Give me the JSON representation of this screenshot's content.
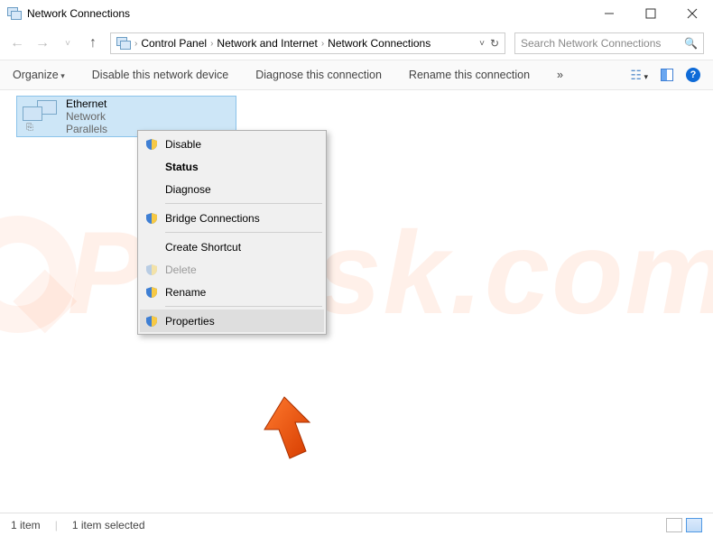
{
  "window": {
    "title": "Network Connections"
  },
  "breadcrumbs": {
    "root": "Control Panel",
    "mid": "Network and Internet",
    "leaf": "Network Connections"
  },
  "search": {
    "placeholder": "Search Network Connections"
  },
  "toolbar": {
    "organize": "Organize",
    "disable": "Disable this network device",
    "diagnose": "Diagnose this connection",
    "rename": "Rename this connection",
    "more": "»"
  },
  "item": {
    "name": "Ethernet",
    "net": "Network",
    "adapter": "Parallels"
  },
  "ctx": {
    "disable": "Disable",
    "status": "Status",
    "diagnose": "Diagnose",
    "bridge": "Bridge Connections",
    "shortcut": "Create Shortcut",
    "delete": "Delete",
    "rename": "Rename",
    "properties": "Properties"
  },
  "status": {
    "count": "1 item",
    "selected": "1 item selected"
  }
}
